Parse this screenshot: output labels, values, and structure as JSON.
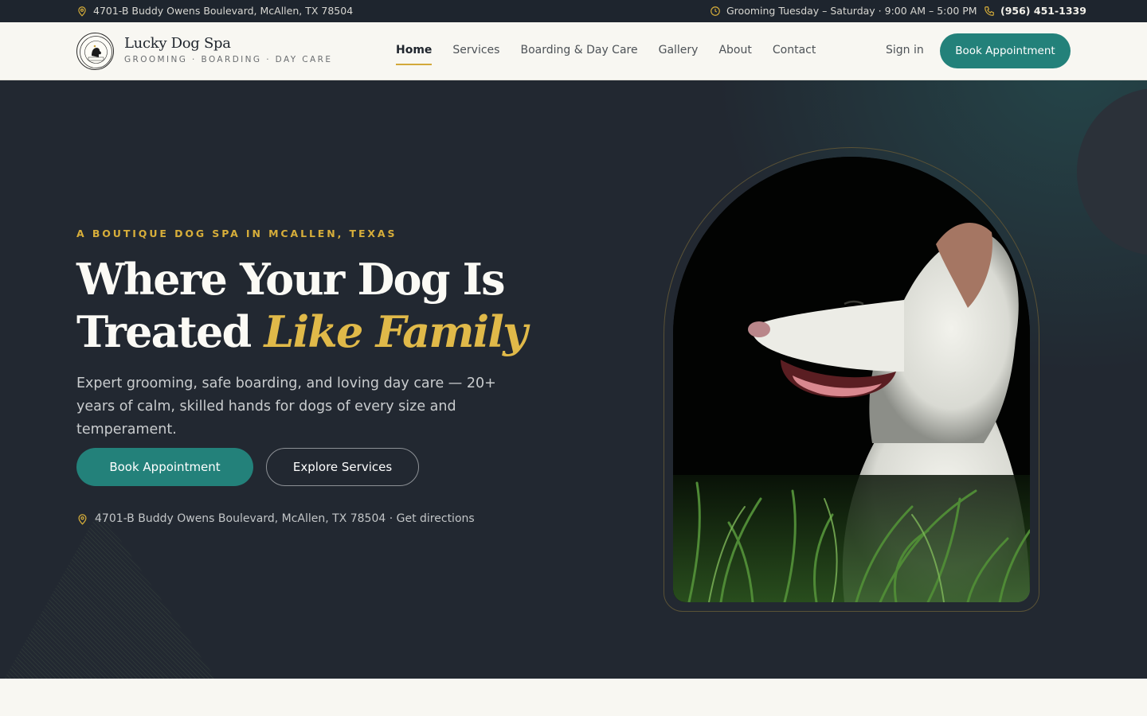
{
  "topbar": {
    "address": "4701-B Buddy Owens Boulevard, McAllen, TX 78504",
    "hours": "Grooming Tuesday – Saturday · 9:00 AM – 5:00 PM",
    "phone": "(956) 451-1339"
  },
  "brand": {
    "name": "Lucky Dog Spa",
    "tagline": "GROOMING · BOARDING · DAY CARE"
  },
  "nav": {
    "links": [
      "Home",
      "Services",
      "Boarding & Day Care",
      "Gallery",
      "About",
      "Contact"
    ],
    "active": "Home",
    "signin": "Sign in",
    "cta": "Book Appointment"
  },
  "hero": {
    "eyebrow": "A BOUTIQUE DOG SPA IN MCALLEN, TEXAS",
    "headline_line1": "Where Your Dog Is",
    "headline_line2_plain": "Treated",
    "headline_line2_accent": "Like Family",
    "lead": "Expert grooming, safe boarding, and loving day care — 20+ years of calm, skilled hands for dogs of every size and temperament.",
    "primary_cta": "Book Appointment",
    "secondary_cta": "Explore Services",
    "address_line": "4701-B Buddy Owens Boulevard, McAllen, TX 78504 · Get directions"
  },
  "icons": {
    "address": "map-pin-icon",
    "hours": "clock-icon",
    "phone": "phone-icon"
  },
  "colors": {
    "accent_teal": "#23817a",
    "accent_gold": "#d7ae3a",
    "hero_bg": "#222831",
    "topbar_bg": "#1e252e"
  }
}
